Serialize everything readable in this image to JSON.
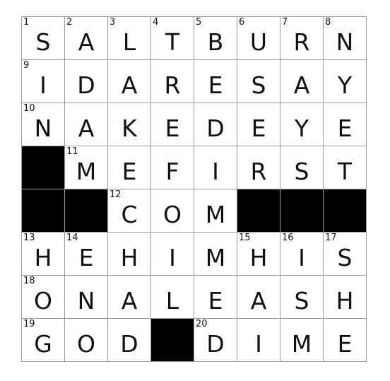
{
  "puzzle": {
    "rows": [
      [
        {
          "n": "1",
          "l": "S"
        },
        {
          "n": "2",
          "l": "A"
        },
        {
          "n": "3",
          "l": "L"
        },
        {
          "n": "4",
          "l": "T"
        },
        {
          "n": "5",
          "l": "B"
        },
        {
          "n": "6",
          "l": "U"
        },
        {
          "n": "7",
          "l": "R"
        },
        {
          "n": "8",
          "l": "N"
        }
      ],
      [
        {
          "n": "9",
          "l": "I"
        },
        {
          "n": "",
          "l": "D"
        },
        {
          "n": "",
          "l": "A"
        },
        {
          "n": "",
          "l": "R"
        },
        {
          "n": "",
          "l": "E"
        },
        {
          "n": "",
          "l": "S"
        },
        {
          "n": "",
          "l": "A"
        },
        {
          "n": "",
          "l": "Y"
        }
      ],
      [
        {
          "n": "10",
          "l": "N"
        },
        {
          "n": "",
          "l": "A"
        },
        {
          "n": "",
          "l": "K"
        },
        {
          "n": "",
          "l": "E"
        },
        {
          "n": "",
          "l": "D"
        },
        {
          "n": "",
          "l": "E"
        },
        {
          "n": "",
          "l": "Y"
        },
        {
          "n": "",
          "l": "E"
        }
      ],
      [
        {
          "black": true
        },
        {
          "n": "11",
          "l": "M"
        },
        {
          "n": "",
          "l": "E"
        },
        {
          "n": "",
          "l": "F"
        },
        {
          "n": "",
          "l": "I"
        },
        {
          "n": "",
          "l": "R"
        },
        {
          "n": "",
          "l": "S"
        },
        {
          "n": "",
          "l": "T"
        }
      ],
      [
        {
          "black": true
        },
        {
          "black": true
        },
        {
          "n": "12",
          "l": "C"
        },
        {
          "n": "",
          "l": "O"
        },
        {
          "n": "",
          "l": "M"
        },
        {
          "black": true
        },
        {
          "black": true
        },
        {
          "black": true
        }
      ],
      [
        {
          "n": "13",
          "l": "H"
        },
        {
          "n": "14",
          "l": "E"
        },
        {
          "n": "",
          "l": "H"
        },
        {
          "n": "",
          "l": "I"
        },
        {
          "n": "",
          "l": "M"
        },
        {
          "n": "15",
          "l": "H"
        },
        {
          "n": "16",
          "l": "I"
        },
        {
          "n": "17",
          "l": "S"
        }
      ],
      [
        {
          "n": "18",
          "l": "O"
        },
        {
          "n": "",
          "l": "N"
        },
        {
          "n": "",
          "l": "A"
        },
        {
          "n": "",
          "l": "L"
        },
        {
          "n": "",
          "l": "E"
        },
        {
          "n": "",
          "l": "A"
        },
        {
          "n": "",
          "l": "S"
        },
        {
          "n": "",
          "l": "H"
        }
      ],
      [
        {
          "n": "19",
          "l": "G"
        },
        {
          "n": "",
          "l": "O"
        },
        {
          "n": "",
          "l": "D"
        },
        {
          "black": true
        },
        {
          "n": "20",
          "l": "D"
        },
        {
          "n": "",
          "l": "I"
        },
        {
          "n": "",
          "l": "M"
        },
        {
          "n": "",
          "l": "E"
        }
      ]
    ]
  },
  "colors": {
    "block": "#000000",
    "grid_line": "#9a9a9a",
    "text": "#111111"
  }
}
